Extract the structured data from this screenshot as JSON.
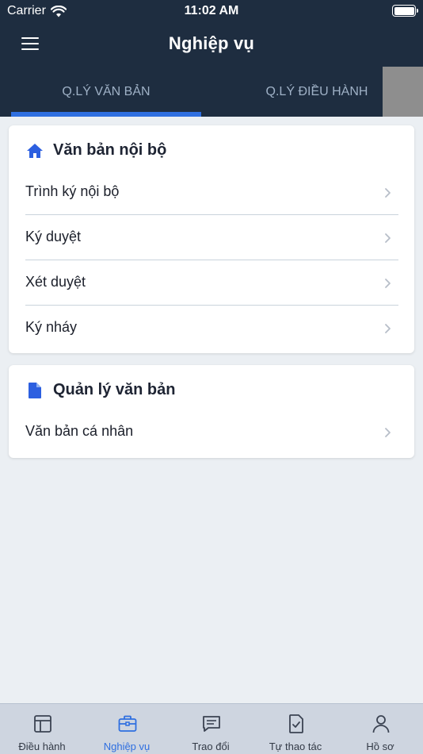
{
  "status_bar": {
    "carrier": "Carrier",
    "time": "11:02 AM",
    "icons": [
      "wifi-icon",
      "battery-icon"
    ]
  },
  "header": {
    "title": "Nghiệp vụ",
    "menu_icon": "hamburger-menu-icon",
    "background": "#1e2d40"
  },
  "tabs": [
    {
      "label": "Q.LÝ VĂN BẢN",
      "active": true
    },
    {
      "label": "Q.LÝ ĐIỀU HÀNH",
      "active": false
    }
  ],
  "sections": [
    {
      "title": "Văn bản nội bộ",
      "icon": "home-icon",
      "items": [
        {
          "label": "Trình ký nội bộ"
        },
        {
          "label": "Ký duyệt"
        },
        {
          "label": "Xét duyệt"
        },
        {
          "label": "Ký nháy"
        }
      ]
    },
    {
      "title": "Quản lý văn bản",
      "icon": "document-icon",
      "items": [
        {
          "label": "Văn bản cá nhân"
        }
      ]
    }
  ],
  "bottom_tabs": [
    {
      "label": "Điều hành",
      "icon": "layout-icon",
      "active": false
    },
    {
      "label": "Nghiệp vụ",
      "icon": "briefcase-icon",
      "active": true
    },
    {
      "label": "Trao đổi",
      "icon": "chat-icon",
      "active": false
    },
    {
      "label": "Tự thao tác",
      "icon": "checklist-icon",
      "active": false
    },
    {
      "label": "Hồ sơ",
      "icon": "user-icon",
      "active": false
    }
  ],
  "colors": {
    "accent": "#2f6fe0",
    "icon_blue": "#2c5fe0",
    "background": "#ebeff3",
    "tab_inactive": "#9fb1c6"
  }
}
